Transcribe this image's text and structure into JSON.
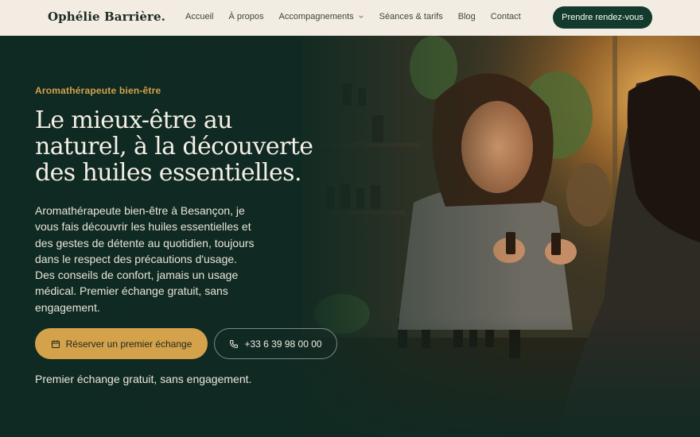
{
  "brand": {
    "name": "Ophélie Barrière."
  },
  "nav": {
    "items": [
      {
        "label": "Accueil"
      },
      {
        "label": "À propos"
      },
      {
        "label": "Accompagnements",
        "icon": "chevron-down-icon"
      },
      {
        "label": "Séances & tarifs"
      },
      {
        "label": "Blog"
      },
      {
        "label": "Contact"
      }
    ],
    "cta_label": "Prendre rendez-vous"
  },
  "hero": {
    "eyebrow": "Aromathérapeute bien-être",
    "headline": "Le mieux-être au naturel, à la découverte des huiles essentielles.",
    "lead": "Aromathérapeute bien-être à Besançon, je vous fais découvrir les huiles essentielles et des gestes de détente au quotidien, toujours dans le respect des précautions d'usage. Des conseils de confort, jamais un usage médical. Premier échange gratuit, sans engagement.",
    "primary_button": {
      "label": "Réserver un premier échange",
      "icon": "calendar-icon"
    },
    "secondary_button": {
      "label": "+33 6 39 98 00 00",
      "icon": "phone-icon"
    },
    "note": "Premier échange gratuit, sans engagement.",
    "image_subject": "aromatherapist-with-essential-oil-bottles"
  },
  "colors": {
    "header_bg": "#f3ece2",
    "brand_dark": "#123a2d",
    "accent_gold": "#d3a24a",
    "hero_bg": "#0f2a23"
  }
}
